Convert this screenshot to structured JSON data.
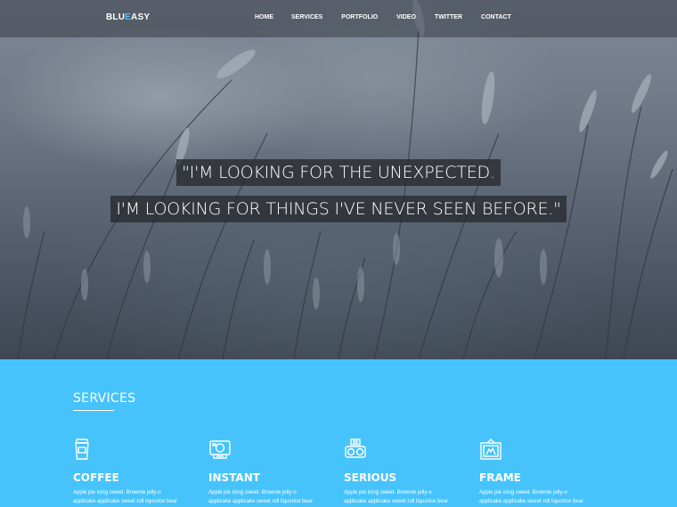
{
  "brand": {
    "prefix": "BLU",
    "accent": "E",
    "suffix": "ASY",
    "accent_color": "#47c3fb"
  },
  "nav": {
    "items": [
      {
        "label": "HOME"
      },
      {
        "label": "SERVICES"
      },
      {
        "label": "PORTFOLIO"
      },
      {
        "label": "VIDEO"
      },
      {
        "label": "TWITTER"
      },
      {
        "label": "CONTACT"
      }
    ]
  },
  "hero": {
    "quote_line_1": "\"I'M LOOKING FOR THE UNEXPECTED.",
    "quote_line_2": "I'M LOOKING FOR THINGS I'VE NEVER SEEN BEFORE.\""
  },
  "services": {
    "title": "SERVICES",
    "background": "#47c3fb",
    "items": [
      {
        "name": "COFFEE",
        "icon": "coffee-cup-icon",
        "desc_line_1": "Apple pie icing sweet. Brownie jelly-o",
        "desc_line_2": "applicake applicake sweet roll liquorice bear"
      },
      {
        "name": "INSTANT",
        "icon": "instant-camera-icon",
        "desc_line_1": "Apple pie icing sweet. Brownie jelly-o",
        "desc_line_2": "applicake applicake sweet roll liquorice bear"
      },
      {
        "name": "SERIOUS",
        "icon": "film-camera-icon",
        "desc_line_1": "Apple pie icing sweet. Brownie jelly-o",
        "desc_line_2": "applicake applicake sweet roll liquorice bear"
      },
      {
        "name": "FRAME",
        "icon": "picture-frame-icon",
        "desc_line_1": "Apple pie icing sweet. Brownie jelly-o",
        "desc_line_2": "applicake applicake sweet roll liquorice bear"
      }
    ]
  }
}
